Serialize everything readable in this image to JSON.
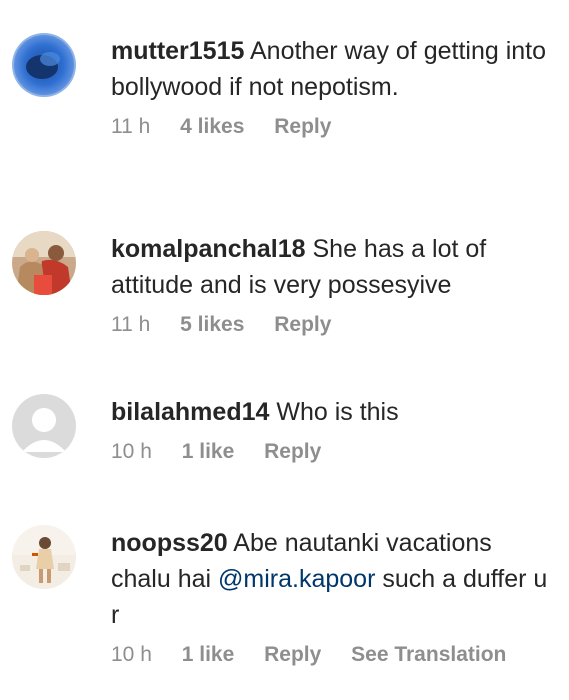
{
  "comments": [
    {
      "username": "mutter1515",
      "text": "Another way of getting into bollywood if not nepotism.",
      "time": "11 h",
      "likes": "4 likes",
      "reply": "Reply"
    },
    {
      "username": "komalpanchal18",
      "text": "She has a lot of attitude and is very possesyive",
      "time": "11 h",
      "likes": "5 likes",
      "reply": "Reply"
    },
    {
      "username": "bilalahmed14",
      "text": "Who is this",
      "time": "10 h",
      "likes": "1 like",
      "reply": "Reply"
    },
    {
      "username": "noopss20",
      "text_before": "Abe nautanki vacations chalu hai",
      "mention": "@mira.kapoor",
      "text_after": "such a duffer u r",
      "time": "10 h",
      "likes": "1 like",
      "reply": "Reply",
      "translate": "See Translation"
    }
  ],
  "colors": {
    "text": "#262626",
    "meta": "#8e8e8e",
    "mention": "#00376b"
  }
}
